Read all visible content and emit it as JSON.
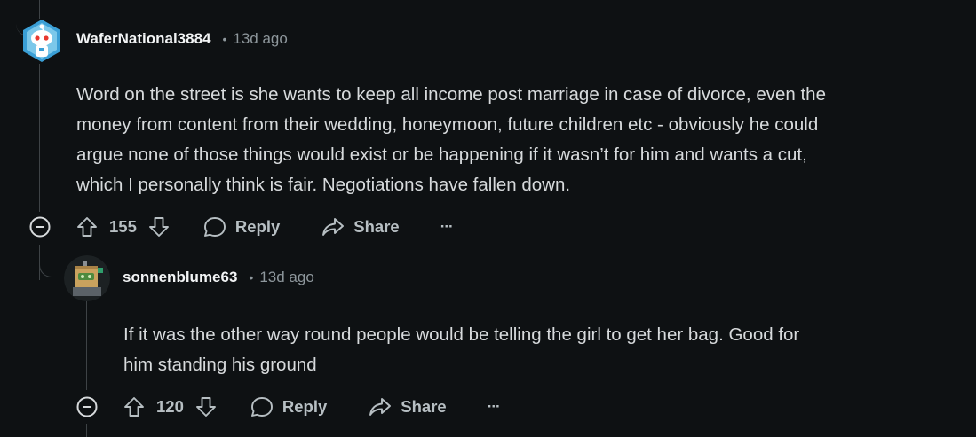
{
  "comments": [
    {
      "author": "WaferNational3884",
      "separator": "•",
      "time": "13d ago",
      "lines": [
        "Word on the street is she wants to keep all income post marriage in case of divorce, even the",
        "money from content from their wedding, honeymoon, future children etc - obviously he could",
        "argue none of those things would exist or be happening if it wasn’t for him and wants a cut,",
        "which I personally think is fair. Negotiations have fallen down."
      ],
      "score": "155",
      "reply_label": "Reply",
      "share_label": "Share",
      "more_label": "···"
    },
    {
      "author": "sonnenblume63",
      "separator": "•",
      "time": "13d ago",
      "lines": [
        "If it was the other way round people would be telling the girl to get her bag. Good for",
        "him standing his ground"
      ],
      "score": "120",
      "reply_label": "Reply",
      "share_label": "Share",
      "more_label": "···"
    }
  ],
  "icons": {
    "collapse": "collapse-minus-icon",
    "upvote": "upvote-arrow-icon",
    "downvote": "downvote-arrow-icon",
    "reply": "speech-bubble-icon",
    "share": "share-arrow-icon"
  },
  "colors": {
    "background": "#0e1113",
    "text": "#d7dadc",
    "muted": "#8e979c"
  }
}
